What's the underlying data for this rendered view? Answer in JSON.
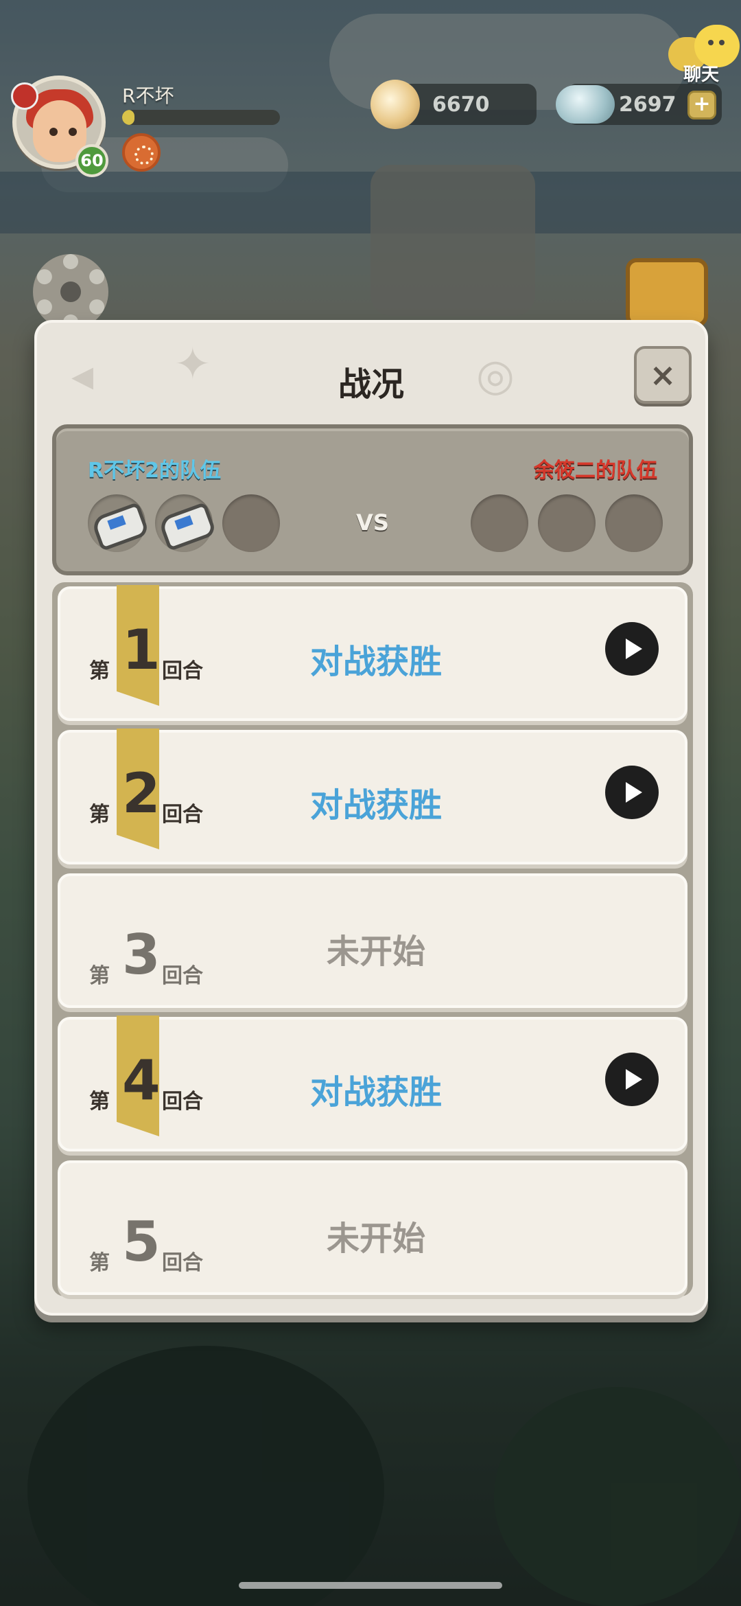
{
  "hud": {
    "player_name": "R不坏",
    "level": "60",
    "xp_progress": 0.08,
    "coins": "6670",
    "gems": "2697",
    "gems_plus": "+",
    "chat_label": "聊天"
  },
  "dialog": {
    "title": "战况",
    "close_label": "×",
    "team_left": "R不坏2的队伍",
    "team_right": "余筱二的队伍",
    "vs": "VS",
    "round_prefix": "第",
    "round_suffix": "回合",
    "rounds": [
      {
        "number": "1",
        "status": "对战获胜"
      },
      {
        "number": "2",
        "status": "对战获胜"
      },
      {
        "number": "3",
        "status": "未开始"
      },
      {
        "number": "4",
        "status": "对战获胜"
      },
      {
        "number": "5",
        "status": "未开始"
      }
    ]
  },
  "colors": {
    "win": "#4aa3d8",
    "pending": "#9b968f",
    "left_team": "#5fc6e8",
    "right_team": "#d6382b",
    "ribbon": "#d3b450"
  }
}
